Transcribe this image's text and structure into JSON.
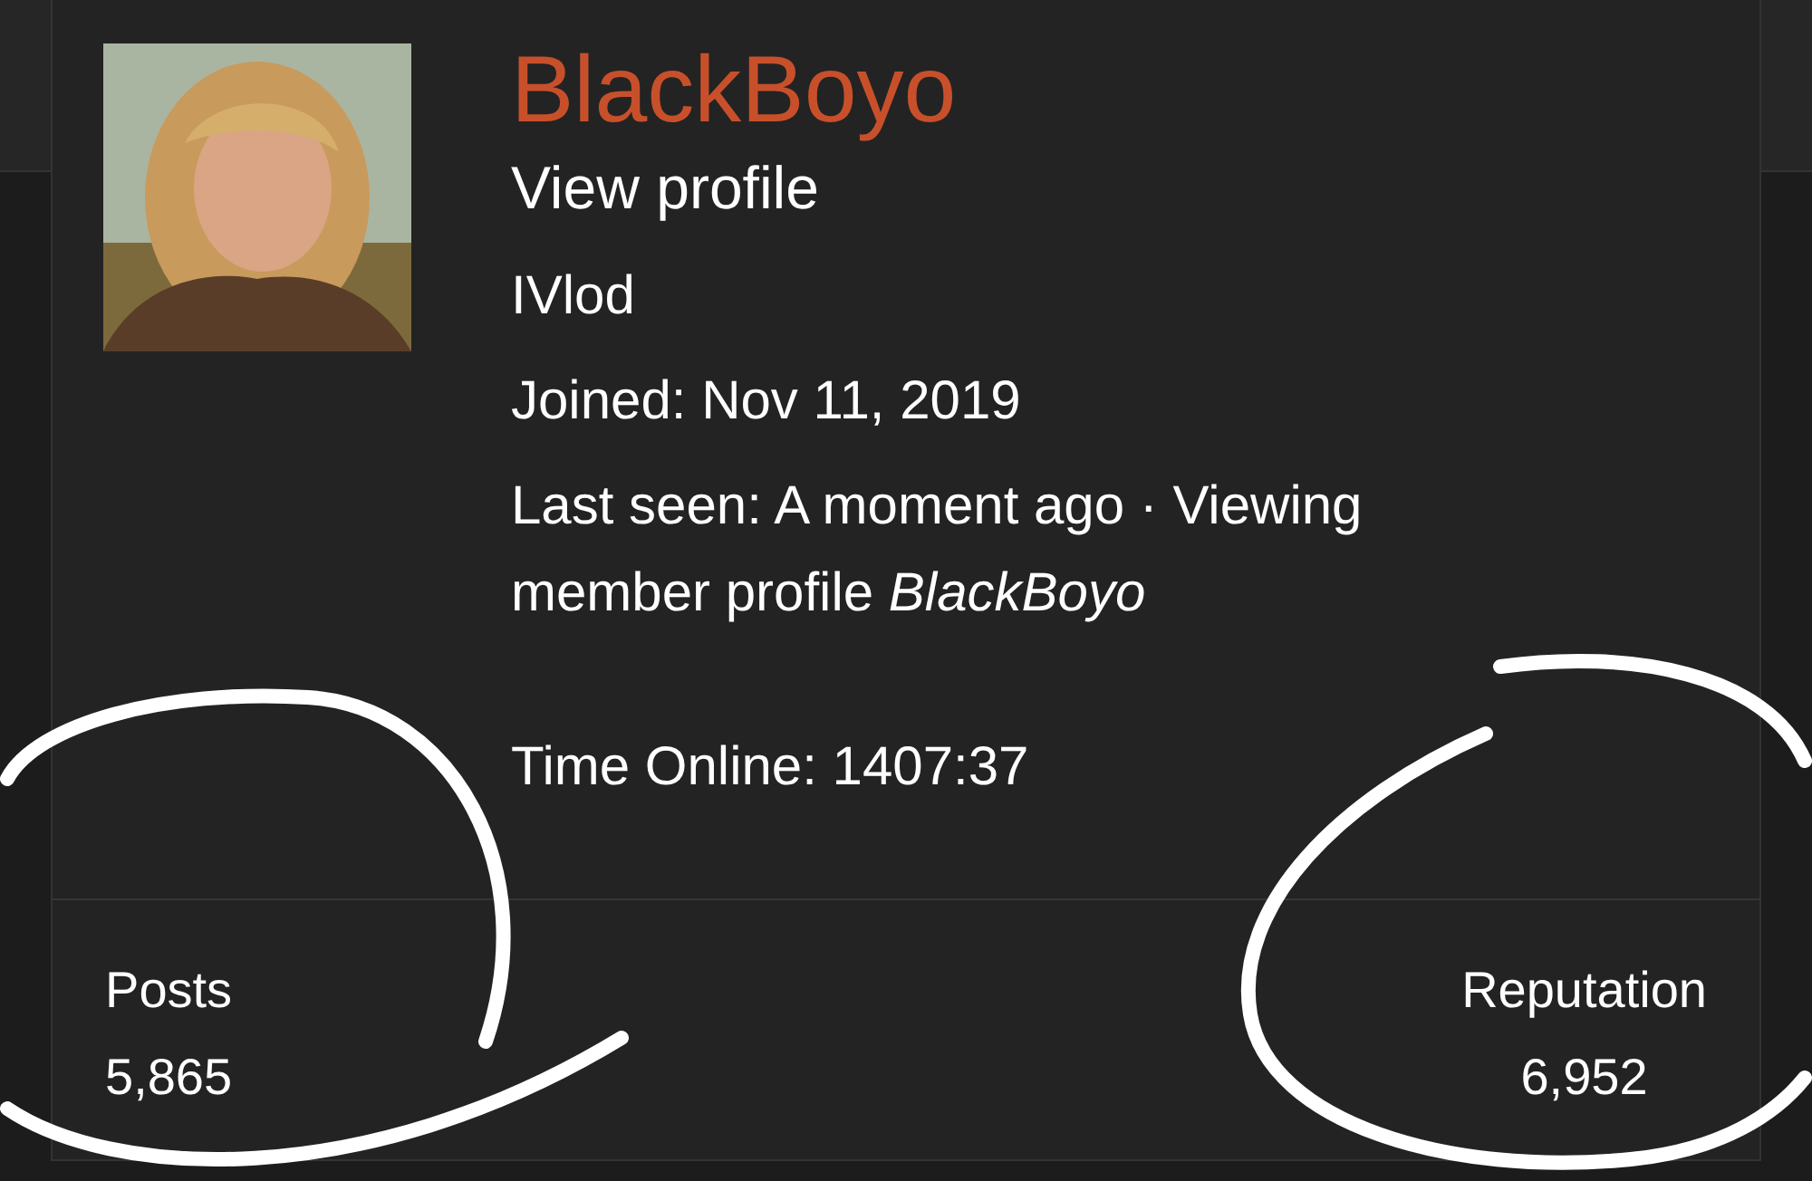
{
  "profile": {
    "username": "BlackBoyo",
    "view_profile": "View profile",
    "group": "IVlod",
    "joined": "Joined: Nov 11, 2019",
    "last_seen": "Last seen: A moment ago · Viewing member profile *BlackBoyo*",
    "time_online": "Time Online: 1407:37"
  },
  "stats": [
    {
      "label": "Posts",
      "value": "5,865"
    },
    {
      "label": "Reputation",
      "value": "6,952"
    }
  ]
}
